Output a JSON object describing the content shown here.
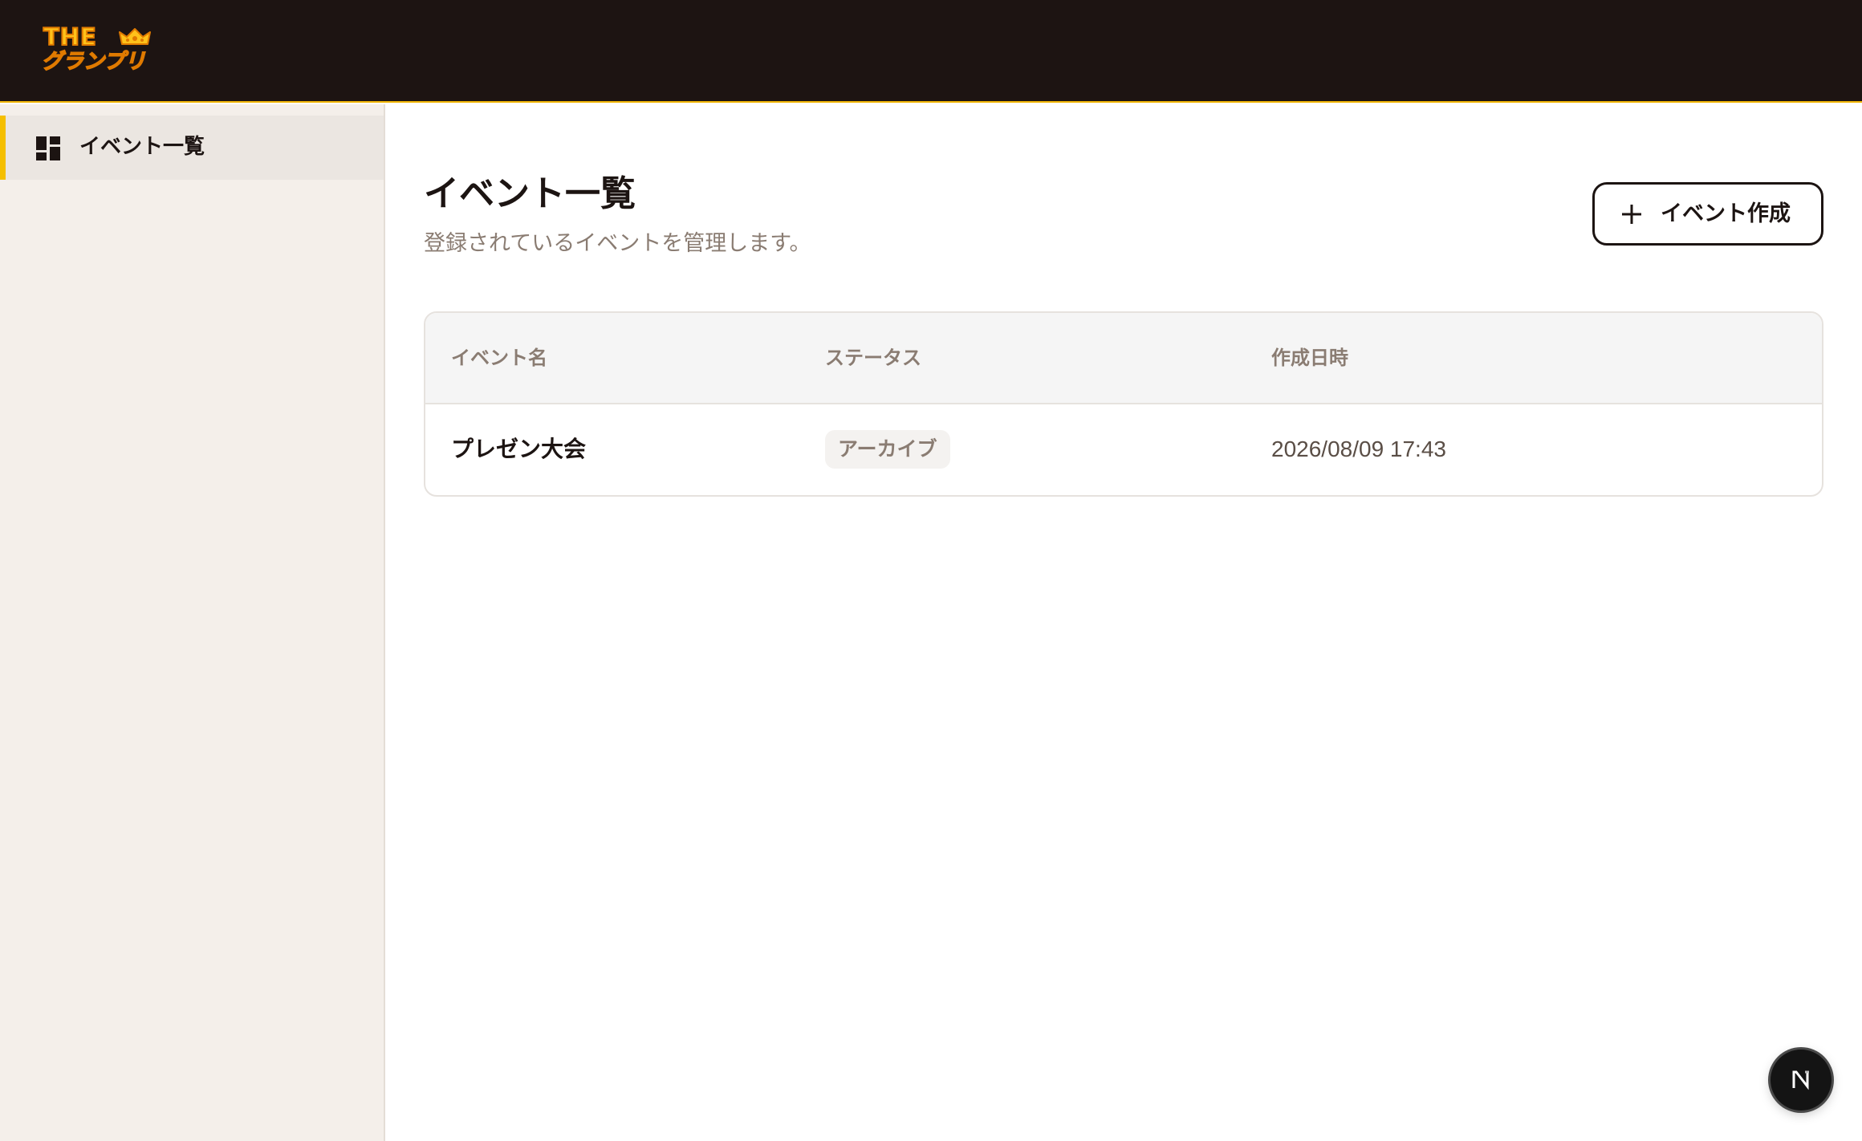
{
  "header": {
    "logo_top": "THE",
    "logo_bottom": "グランプリ"
  },
  "sidebar": {
    "items": [
      {
        "label": "イベント一覧",
        "icon": "dashboard-icon",
        "active": true
      }
    ]
  },
  "main": {
    "title": "イベント一覧",
    "subtitle": "登録されているイベントを管理します。",
    "create_button_label": "イベント作成"
  },
  "table": {
    "columns": [
      "イベント名",
      "ステータス",
      "作成日時"
    ],
    "rows": [
      {
        "name": "プレゼン大会",
        "status": "アーカイブ",
        "created_at": "2026/08/09 17:43"
      }
    ]
  },
  "floating_button": {
    "icon": "nextjs-icon"
  },
  "colors": {
    "header_bg": "#1d1412",
    "accent": "#f5bf00",
    "sidebar_bg": "#f4efea",
    "text_primary": "#1c1412",
    "text_muted": "#8a7c72"
  }
}
